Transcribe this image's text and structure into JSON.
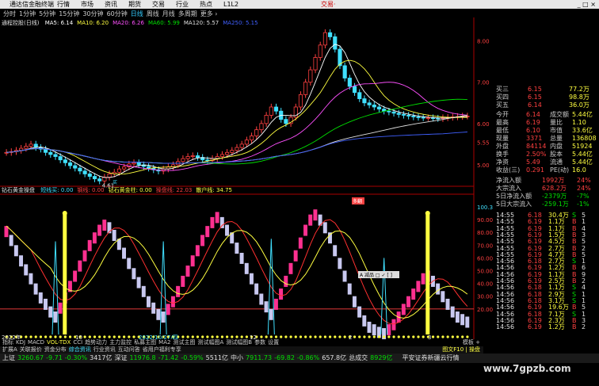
{
  "window": {
    "title": "通达信金融终端",
    "menus": [
      "行情",
      "市场",
      "资讯",
      "期货",
      "交易",
      "行业",
      "热点",
      "L1L2"
    ],
    "trade_link": "交易·",
    "win_buttons": "_ □ ×"
  },
  "periods": {
    "items": [
      "分时",
      "1分钟",
      "5分钟",
      "15分钟",
      "30分钟",
      "60分钟",
      "日线",
      "周线",
      "月线",
      "多周期",
      "更多 ›"
    ],
    "selected_index": 6
  },
  "main_legend": {
    "stock": "通程控股(日线)",
    "ma": [
      {
        "label": "MA5: 6.14",
        "color": "#ffffff"
      },
      {
        "label": "MA10: 6.20",
        "color": "#ffff40"
      },
      {
        "label": "MA20: 6.26",
        "color": "#ff50ff"
      },
      {
        "label": "MA60: 5.99",
        "color": "#00e000"
      },
      {
        "label": "MA120: 5.57",
        "color": "#e0e0e0"
      },
      {
        "label": "MA250: 5.15",
        "color": "#4060ff"
      }
    ]
  },
  "price_axis": [
    "8.00",
    "7.00",
    "6.00",
    "5.55",
    "5.00"
  ],
  "annotations": {
    "low_label": "4.61",
    "sub_marker": "买",
    "top_badge": "多翻",
    "float_box": "A 减品 □ ✓ [ ]"
  },
  "sub_legend": {
    "name": "钻石黄金操盘",
    "items": [
      {
        "label": "短线买: 0.00",
        "color": "#40e0ff"
      },
      {
        "label": "钢线: 0.00",
        "color": "#ff4040"
      },
      {
        "label": "钻石黄金柱: 0.00",
        "color": "#ffff40"
      },
      {
        "label": "操盘线: 22.03",
        "color": "#ff4040"
      },
      {
        "label": "散户线: 34.75",
        "color": "#ffff40"
      }
    ]
  },
  "sub_axis": [
    "100.34",
    "90.00",
    "80.00",
    "70.00",
    "60.00",
    "50.00",
    "40.00",
    "30.00",
    "20.00"
  ],
  "x_axis": [
    "2022年",
    "10",
    "2022/10/27/四",
    "12",
    "2",
    "3"
  ],
  "quotes": {
    "top_rows": [
      {
        "l": "买三",
        "v": "6.15",
        "r": "77.2万"
      },
      {
        "l": "买四",
        "v": "6.15",
        "r": "98.8万"
      },
      {
        "l": "买五",
        "v": "6.14",
        "r": "36.0万"
      }
    ],
    "info_rows": [
      {
        "l": "今开",
        "v": "6.14",
        "k": "成交额",
        "kv": "5.44亿"
      },
      {
        "l": "最高",
        "v": "6.19",
        "k": "量比",
        "kv": "1.10"
      },
      {
        "l": "最低",
        "v": "6.10",
        "k": "市值",
        "kv": "33.6亿"
      },
      {
        "l": "现量",
        "v": "3371",
        "k": "总量",
        "kv": "136808"
      },
      {
        "l": "外盘",
        "v": "84114",
        "k": "内盘",
        "kv": "51924"
      },
      {
        "l": "换手",
        "v": "2.50%",
        "k": "股本",
        "kv": "5.44亿"
      },
      {
        "l": "净资",
        "v": "5.49",
        "k": "流通",
        "kv": "5.44亿"
      },
      {
        "l": "收益(三)",
        "v": "0.291",
        "k": "PE(动)",
        "kv": "16.0"
      }
    ],
    "flow_rows": [
      {
        "l": "净流入额",
        "v": "1992万",
        "p": "24%",
        "color": "#ff4040"
      },
      {
        "l": "大宗流入",
        "v": "628.2万",
        "p": "24%",
        "color": "#ff4040"
      },
      {
        "l": "5日净流入额",
        "v": "-2379万",
        "p": "-7%",
        "color": "#00e000"
      },
      {
        "l": "5日大宗流入",
        "v": "-259.1万",
        "p": "-1%",
        "color": "#00e000"
      }
    ],
    "ticks": [
      {
        "t": "14:55",
        "p": "6.18",
        "v": "30.4万",
        "s": "S",
        "n": "5"
      },
      {
        "t": "14:55",
        "p": "6.19",
        "v": "1.1万",
        "s": "B",
        "n": "1"
      },
      {
        "t": "14:55",
        "p": "6.19",
        "v": "1.1万",
        "s": "B",
        "n": "4"
      },
      {
        "t": "14:55",
        "p": "6.19",
        "v": "1.5万",
        "s": "B",
        "n": "3"
      },
      {
        "t": "14:55",
        "p": "6.19",
        "v": "4.5万",
        "s": "B",
        "n": "5"
      },
      {
        "t": "14:55",
        "p": "6.19",
        "v": "2.7万",
        "s": "B",
        "n": "2"
      },
      {
        "t": "14:55",
        "p": "6.19",
        "v": "4.7万",
        "s": "B",
        "n": "5"
      },
      {
        "t": "14:56",
        "p": "6.18",
        "v": "2.7万",
        "s": "S",
        "n": "1"
      },
      {
        "t": "14:56",
        "p": "6.19",
        "v": "1.2万",
        "s": "B",
        "n": "6"
      },
      {
        "t": "14:56",
        "p": "6.19",
        "v": "1.1万",
        "s": "B",
        "n": "9"
      },
      {
        "t": "14:56",
        "p": "6.19",
        "v": "2.5万",
        "s": "B",
        "n": "2"
      },
      {
        "t": "14:56",
        "p": "6.18",
        "v": "1.1万",
        "s": "S",
        "n": "4"
      },
      {
        "t": "14:56",
        "p": "6.18",
        "v": "2.9万",
        "s": "S",
        "n": "1"
      },
      {
        "t": "14:56",
        "p": "6.18",
        "v": "3.1万",
        "s": "S",
        "n": "1"
      },
      {
        "t": "14:56",
        "p": "6.19",
        "v": "19.6万",
        "s": "B",
        "n": "5"
      },
      {
        "t": "14:56",
        "p": "6.18",
        "v": "7.1万",
        "s": "S",
        "n": "1"
      },
      {
        "t": "14:56",
        "p": "6.19",
        "v": "2.3万",
        "s": "B",
        "n": "3"
      },
      {
        "t": "14:56",
        "p": "6.19",
        "v": "1.2万",
        "s": "B",
        "n": "2"
      }
    ],
    "right_edge": [
      "涨",
      "跌",
      "幅",
      "价",
      "量",
      "盘",
      "分",
      "笔",
      "价",
      "细",
      "势",
      "指",
      "联",
      "值",
      "研",
      "F10"
    ]
  },
  "tabs1": [
    "指标",
    "KDJ",
    "MACD",
    "VOL-TDX",
    "CCI",
    "趋势动力",
    "主力监控",
    "私募主图",
    "MA2",
    "测试主图",
    "测试幅图A",
    "测试幅图B",
    "参数",
    "设置"
  ],
  "tabs1_right": "模板 +",
  "tabs2": [
    "扩展A",
    "关联报价",
    "资金分布",
    "综合资讯",
    "行业资讯",
    "互动问答",
    "省用户福利专享"
  ],
  "tabs2_right": "图文F10 | 操盘",
  "status": [
    {
      "label": "上证",
      "v": "3260.67",
      "c": "-9.71",
      "p": "-0.30%",
      "a": "3417亿"
    },
    {
      "label": "深证",
      "v": "11976.8",
      "c": "-71.42",
      "p": "-0.59%",
      "a": "5511亿"
    },
    {
      "label": "中小",
      "v": "7911.73",
      "c": "-69.82",
      "p": "-0.86%",
      "a": "657.8亿"
    },
    {
      "label": "总成交",
      "v": "8929亿",
      "c": "",
      "p": "",
      "a": ""
    }
  ],
  "status_right": "平安证券新疆云行情",
  "watermark": "www.7gpzb.com",
  "chart_data": [
    {
      "type": "candlestick",
      "title": "通程控股(日线)",
      "ylim": [
        4.5,
        8.3
      ],
      "closes": [
        5.3,
        5.32,
        5.35,
        5.4,
        5.45,
        5.5,
        5.42,
        5.38,
        5.3,
        5.25,
        5.2,
        5.12,
        5.05,
        4.98,
        4.92,
        4.85,
        4.78,
        4.72,
        4.66,
        4.61,
        4.7,
        4.78,
        4.82,
        4.9,
        4.95,
        5.02,
        5.05,
        5.0,
        4.96,
        4.92,
        4.88,
        4.85,
        4.9,
        4.95,
        5.0,
        5.08,
        5.15,
        5.2,
        5.22,
        5.18,
        5.12,
        5.1,
        5.15,
        5.2,
        5.25,
        5.3,
        5.35,
        5.42,
        5.5,
        5.6,
        5.7,
        5.85,
        6.0,
        6.2,
        6.4,
        6.3,
        6.1,
        6.0,
        6.15,
        6.4,
        6.7,
        7.0,
        7.3,
        7.6,
        7.9,
        8.2,
        8.1,
        7.8,
        7.4,
        7.1,
        6.9,
        6.75,
        6.6,
        6.5,
        6.45,
        6.4,
        6.35,
        6.3,
        6.28,
        6.25,
        6.22,
        6.2,
        6.18,
        6.16,
        6.15,
        6.14,
        6.14,
        6.13,
        6.12,
        6.14,
        6.15,
        6.16,
        6.17,
        6.18,
        6.18
      ]
    },
    {
      "type": "bar",
      "title": "钻石黄金操盘",
      "ylim": [
        0,
        100
      ],
      "values": [
        85,
        78,
        70,
        62,
        55,
        48,
        40,
        33,
        28,
        22,
        18,
        25,
        33,
        42,
        50,
        58,
        66,
        74,
        80,
        86,
        90,
        88,
        82,
        75,
        68,
        60,
        52,
        45,
        38,
        30,
        25,
        20,
        18,
        24,
        30,
        38,
        46,
        54,
        62,
        70,
        78,
        85,
        92,
        96,
        92,
        86,
        80,
        72,
        64,
        56,
        48,
        40,
        32,
        26,
        20,
        28,
        36,
        46,
        56,
        66,
        76,
        86,
        94,
        98,
        94,
        88,
        80,
        70,
        60,
        50,
        40,
        30,
        22,
        15,
        10,
        8,
        6,
        5,
        8,
        12,
        18,
        24,
        30,
        36,
        42,
        48,
        50,
        46,
        40,
        34,
        28,
        22,
        18,
        16,
        14
      ],
      "gold_bars_at_index": [
        12,
        86
      ],
      "threshold_line": 20
    }
  ]
}
